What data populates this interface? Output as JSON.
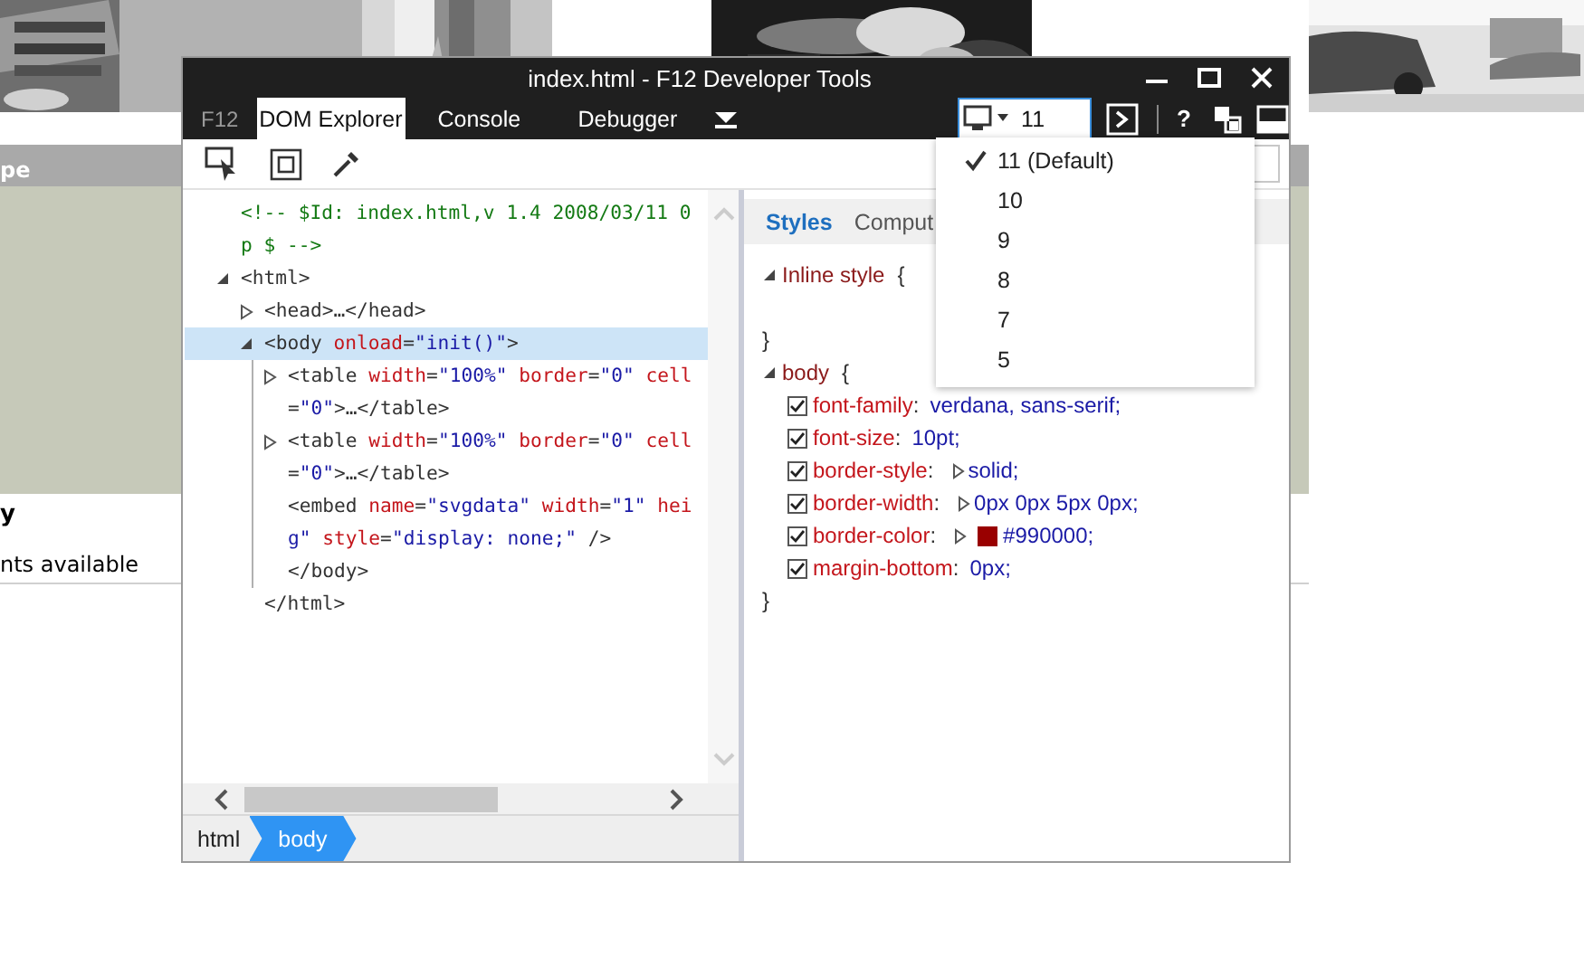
{
  "background": {
    "banner_text": "pe",
    "heading": "y",
    "note": "nts available"
  },
  "devtools": {
    "title": "index.html - F12 Developer Tools",
    "brand": "F12",
    "tabs": [
      {
        "label": "DOM Explorer",
        "selected": true
      },
      {
        "label": "Console",
        "selected": false
      },
      {
        "label": "Debugger",
        "selected": false
      }
    ],
    "version_field": {
      "value": "11"
    },
    "help": "?",
    "version_menu": [
      {
        "label": "11 (Default)",
        "checked": true
      },
      {
        "label": "10",
        "checked": false
      },
      {
        "label": "9",
        "checked": false
      },
      {
        "label": "8",
        "checked": false
      },
      {
        "label": "7",
        "checked": false
      },
      {
        "label": "5",
        "checked": false
      }
    ],
    "dom_tree": [
      {
        "selected": false,
        "lines": [
          [
            {
              "kind": "comment",
              "text": "<!-- $Id: index.html,v 1.4 2008/03/11 0"
            }
          ],
          [
            {
              "kind": "comment",
              "text": "p $ -->"
            }
          ]
        ]
      },
      {
        "selected": false,
        "expanded": true,
        "lines": [
          [
            {
              "kind": "tag",
              "text": "<html>"
            }
          ]
        ],
        "closing": "</html>",
        "children": [
          {
            "selected": false,
            "expanded": false,
            "lines": [
              [
                {
                  "kind": "tag",
                  "text": "<head>…</head>"
                }
              ]
            ]
          },
          {
            "selected": true,
            "expanded": true,
            "lines": [
              [
                {
                  "kind": "tag",
                  "text": "<body "
                },
                {
                  "kind": "attr",
                  "text": "onload"
                },
                {
                  "kind": "tag",
                  "text": "="
                },
                {
                  "kind": "value",
                  "text": "\"init()\""
                },
                {
                  "kind": "tag",
                  "text": ">"
                }
              ]
            ],
            "closing": "</body>",
            "children": [
              {
                "selected": false,
                "expanded": false,
                "lines": [
                  [
                    {
                      "kind": "tag",
                      "text": "<table "
                    },
                    {
                      "kind": "attr",
                      "text": "width"
                    },
                    {
                      "kind": "tag",
                      "text": "="
                    },
                    {
                      "kind": "value",
                      "text": "\"100%\""
                    },
                    {
                      "kind": "attr",
                      "text": " border"
                    },
                    {
                      "kind": "tag",
                      "text": "="
                    },
                    {
                      "kind": "value",
                      "text": "\"0\""
                    },
                    {
                      "kind": "attr",
                      "text": " cell"
                    }
                  ],
                  [
                    {
                      "kind": "tag",
                      "text": "="
                    },
                    {
                      "kind": "value",
                      "text": "\"0\""
                    },
                    {
                      "kind": "tag",
                      "text": ">…</table>"
                    }
                  ]
                ]
              },
              {
                "selected": false,
                "expanded": false,
                "lines": [
                  [
                    {
                      "kind": "tag",
                      "text": "<table "
                    },
                    {
                      "kind": "attr",
                      "text": "width"
                    },
                    {
                      "kind": "tag",
                      "text": "="
                    },
                    {
                      "kind": "value",
                      "text": "\"100%\""
                    },
                    {
                      "kind": "attr",
                      "text": " border"
                    },
                    {
                      "kind": "tag",
                      "text": "="
                    },
                    {
                      "kind": "value",
                      "text": "\"0\""
                    },
                    {
                      "kind": "attr",
                      "text": " cell"
                    }
                  ],
                  [
                    {
                      "kind": "tag",
                      "text": "="
                    },
                    {
                      "kind": "value",
                      "text": "\"0\""
                    },
                    {
                      "kind": "tag",
                      "text": ">…</table>"
                    }
                  ]
                ]
              },
              {
                "selected": false,
                "lines": [
                  [
                    {
                      "kind": "tag",
                      "text": "<embed "
                    },
                    {
                      "kind": "attr",
                      "text": "name"
                    },
                    {
                      "kind": "tag",
                      "text": "="
                    },
                    {
                      "kind": "value",
                      "text": "\"svgdata\""
                    },
                    {
                      "kind": "attr",
                      "text": " width"
                    },
                    {
                      "kind": "tag",
                      "text": "="
                    },
                    {
                      "kind": "value",
                      "text": "\"1\""
                    },
                    {
                      "kind": "attr",
                      "text": " hei"
                    }
                  ],
                  [
                    {
                      "kind": "value",
                      "text": "g\""
                    },
                    {
                      "kind": "attr",
                      "text": " style"
                    },
                    {
                      "kind": "tag",
                      "text": "="
                    },
                    {
                      "kind": "value",
                      "text": "\"display: none;\""
                    },
                    {
                      "kind": "tag",
                      "text": " />"
                    }
                  ]
                ]
              }
            ]
          }
        ]
      }
    ],
    "breadcrumbs": [
      {
        "label": "html",
        "selected": false
      },
      {
        "label": "body",
        "selected": true
      }
    ],
    "style_tabs": [
      {
        "label": "Styles",
        "selected": true
      },
      {
        "label": "Comput",
        "selected": false
      }
    ],
    "style_rules": [
      {
        "selector": "Inline style",
        "open_brace": "{",
        "close_brace": "}",
        "expanded": true
      },
      {
        "selector": "body",
        "open_brace": "{",
        "close_brace": "}",
        "expanded": true,
        "properties": [
          {
            "name": "font-family",
            "separator": ":",
            "value": "verdana, sans-serif;",
            "checked": true
          },
          {
            "name": "font-size",
            "separator": ":",
            "value": "10pt;",
            "checked": true
          },
          {
            "name": "border-style",
            "separator": ":",
            "value": "solid;",
            "checked": true,
            "expanded": false
          },
          {
            "name": "border-width",
            "separator": ":",
            "value": "0px 0px 5px 0px;",
            "checked": true,
            "expanded": false
          },
          {
            "name": "border-color",
            "separator": ":",
            "value": "#990000;",
            "checked": true,
            "expanded": false,
            "color": "#990000"
          },
          {
            "name": "margin-bottom",
            "separator": ":",
            "value": "0px;",
            "checked": true
          }
        ]
      }
    ]
  }
}
